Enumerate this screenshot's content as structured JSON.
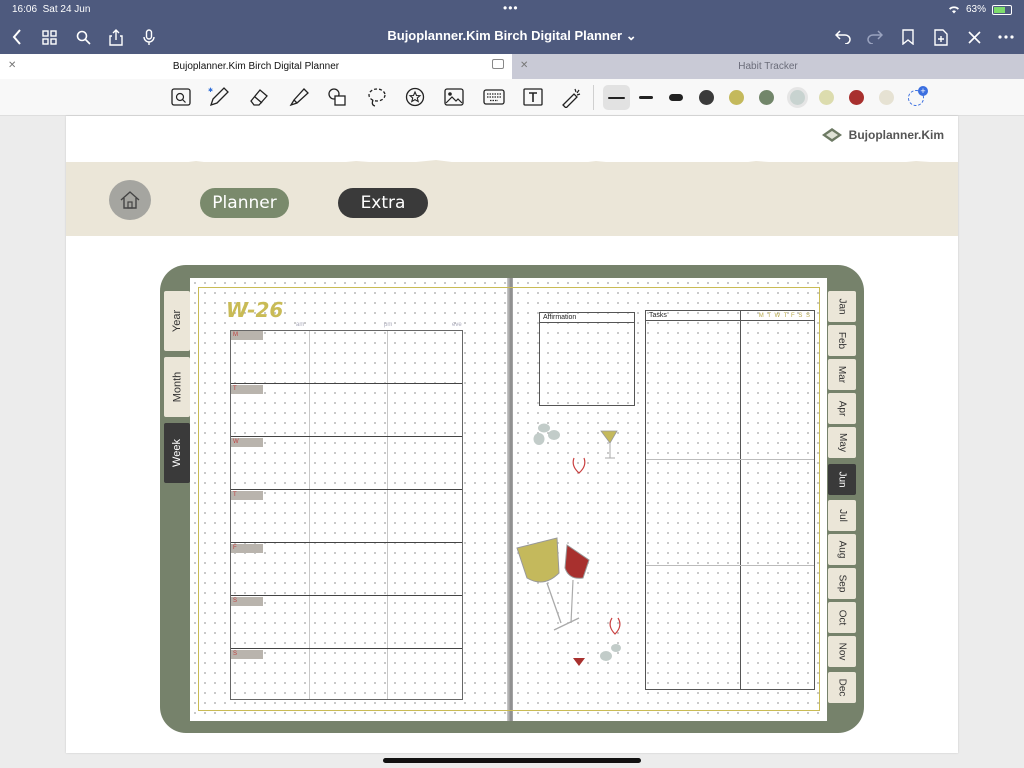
{
  "status": {
    "time": "16:06",
    "date": "Sat 24 Jun",
    "battery": "63%"
  },
  "nav": {
    "title": "Bujoplanner.Kim Birch Digital Planner ⌄"
  },
  "tabs": [
    {
      "label": "Bujoplanner.Kim Birch Digital Planner"
    },
    {
      "label": "Habit Tracker"
    }
  ],
  "toolbar": {
    "tools": [
      "zoom-box-icon",
      "pen-icon",
      "eraser-icon",
      "highlighter-icon",
      "shapes-icon",
      "lasso-icon",
      "sticker-icon",
      "image-icon",
      "keyboard-icon",
      "text-box-icon",
      "laser-pointer-icon"
    ],
    "colors": [
      "#3a3a3a",
      "#c4b95c",
      "#72866a",
      "#c8d3d0",
      "#dcdcae",
      "#a8302e",
      "#e6e2d3"
    ]
  },
  "page": {
    "brand": "Bujoplanner.Kim",
    "nav_planner": "Planner",
    "nav_extra": "Extra",
    "week_label": "W-26",
    "col_heads": [
      "am",
      "pm",
      "eve"
    ],
    "days": [
      "M",
      "T",
      "W",
      "T",
      "F",
      "S",
      "S"
    ],
    "affirmation_label": "Affirmation",
    "tasks_label": "Tasks",
    "habit_days": "M T W T F S S",
    "left_tabs": [
      "Year",
      "Month",
      "Week"
    ],
    "active_left_tab": "Week",
    "months": [
      "Jan",
      "Feb",
      "Mar",
      "Apr",
      "May",
      "Jun",
      "Jul",
      "Aug",
      "Sep",
      "Oct",
      "Nov",
      "Dec"
    ],
    "active_month": "Jun"
  }
}
